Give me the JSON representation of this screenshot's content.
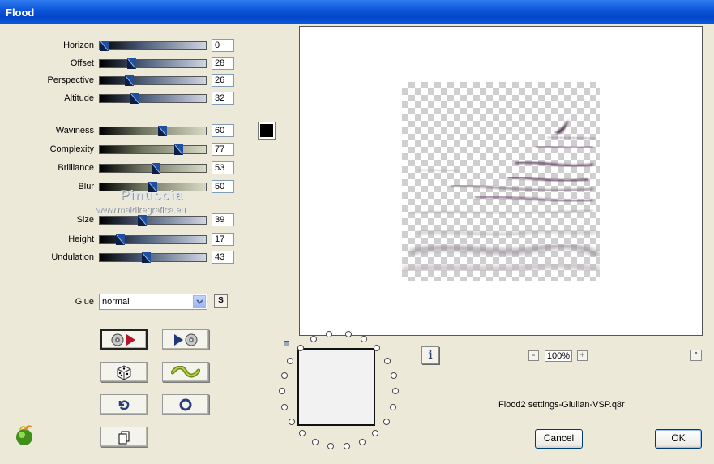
{
  "window": {
    "title": "Flood"
  },
  "sliders": [
    {
      "label": "Horizon",
      "value": "0",
      "percent": 0,
      "style": "blue"
    },
    {
      "label": "Offset",
      "value": "28",
      "percent": 28,
      "style": "blue"
    },
    {
      "label": "Perspective",
      "value": "26",
      "percent": 26,
      "style": "blue"
    },
    {
      "label": "Altitude",
      "value": "32",
      "percent": 32,
      "style": "blue"
    },
    {
      "label": "Waviness",
      "value": "60",
      "percent": 60,
      "style": "olive"
    },
    {
      "label": "Complexity",
      "value": "77",
      "percent": 77,
      "style": "olive"
    },
    {
      "label": "Brilliance",
      "value": "53",
      "percent": 53,
      "style": "olive"
    },
    {
      "label": "Blur",
      "value": "50",
      "percent": 50,
      "style": "olive"
    },
    {
      "label": "Size",
      "value": "39",
      "percent": 39,
      "style": "blue"
    },
    {
      "label": "Height",
      "value": "17",
      "percent": 17,
      "style": "blue"
    },
    {
      "label": "Undulation",
      "value": "43",
      "percent": 43,
      "style": "blue"
    }
  ],
  "color_swatch": "#000000",
  "watermark": {
    "line1": "Pinuccia",
    "line2": "www.maidiregrafica.eu"
  },
  "glue": {
    "label": "Glue",
    "value": "normal",
    "s_button": "S"
  },
  "preview": {
    "zoom": "100%",
    "zoom_minus": "-",
    "zoom_plus": "+",
    "info": "i",
    "up": "^"
  },
  "preset": {
    "filename": "Flood2 settings-Giulian-VSP.q8r"
  },
  "buttons": {
    "cancel": "Cancel",
    "ok": "OK"
  },
  "colors": {
    "titlebar": "#0a53d8",
    "background": "#ece9d8",
    "slider_thumb": "#1f4fa0"
  }
}
